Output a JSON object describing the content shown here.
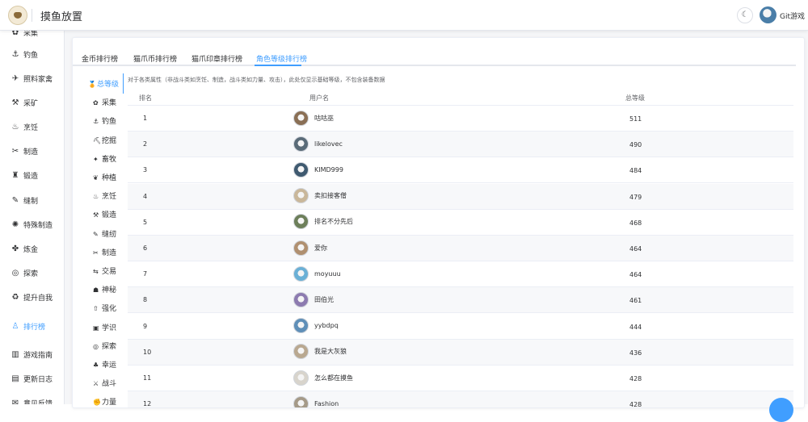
{
  "header": {
    "app_title": "摸鱼放置",
    "theme_icon": "moon-icon",
    "user_name": "Git游戏"
  },
  "sidebar": {
    "items": [
      {
        "label": "采集",
        "icon": "gather-icon",
        "active": false
      },
      {
        "label": "钓鱼",
        "icon": "fishing-icon",
        "active": false
      },
      {
        "label": "照料家禽",
        "icon": "poultry-icon",
        "active": false
      },
      {
        "label": "采矿",
        "icon": "mining-icon",
        "active": false
      },
      {
        "label": "烹饪",
        "icon": "cooking-icon",
        "active": false
      },
      {
        "label": "制造",
        "icon": "crafting-icon",
        "active": false
      },
      {
        "label": "锻造",
        "icon": "forging-icon",
        "active": false
      },
      {
        "label": "缝制",
        "icon": "sewing-icon",
        "active": false
      },
      {
        "label": "特殊制造",
        "icon": "special-craft-icon",
        "active": false
      },
      {
        "label": "炼金",
        "icon": "alchemy-icon",
        "active": false
      },
      {
        "label": "探索",
        "icon": "explore-icon",
        "active": false
      },
      {
        "label": "提升自我",
        "icon": "self-improve-icon",
        "active": false
      },
      {
        "label": "排行榜",
        "icon": "leaderboard-icon",
        "active": true
      },
      {
        "label": "游戏指南",
        "icon": "guide-icon",
        "active": false
      },
      {
        "label": "更新日志",
        "icon": "changelog-icon",
        "active": false
      },
      {
        "label": "意见反馈",
        "icon": "feedback-icon",
        "active": false
      }
    ]
  },
  "tabs": [
    {
      "label": "金币排行榜",
      "active": false
    },
    {
      "label": "猫爪币排行榜",
      "active": false
    },
    {
      "label": "猫爪印章排行榜",
      "active": false
    },
    {
      "label": "角色等级排行榜",
      "active": true
    }
  ],
  "subnav": [
    {
      "label": "总等级",
      "icon": "medal-icon",
      "active": true
    },
    {
      "label": "采集",
      "icon": "gather-icon",
      "active": false
    },
    {
      "label": "钓鱼",
      "icon": "fishing-icon",
      "active": false
    },
    {
      "label": "挖掘",
      "icon": "pickaxe-icon",
      "active": false
    },
    {
      "label": "畜牧",
      "icon": "livestock-icon",
      "active": false
    },
    {
      "label": "种植",
      "icon": "planting-icon",
      "active": false
    },
    {
      "label": "烹饪",
      "icon": "cooking-icon",
      "active": false
    },
    {
      "label": "锻造",
      "icon": "hammer-icon",
      "active": false
    },
    {
      "label": "缝纫",
      "icon": "sewing-icon",
      "active": false
    },
    {
      "label": "制造",
      "icon": "tools-icon",
      "active": false
    },
    {
      "label": "交易",
      "icon": "trade-icon",
      "active": false
    },
    {
      "label": "神秘",
      "icon": "mystic-icon",
      "active": false
    },
    {
      "label": "强化",
      "icon": "upgrade-icon",
      "active": false
    },
    {
      "label": "学识",
      "icon": "book-icon",
      "active": false
    },
    {
      "label": "探索",
      "icon": "compass-icon",
      "active": false
    },
    {
      "label": "幸运",
      "icon": "clover-icon",
      "active": false
    },
    {
      "label": "战斗",
      "icon": "fight-icon",
      "active": false
    },
    {
      "label": "力量",
      "icon": "strength-icon",
      "active": false
    }
  ],
  "description": "对于各类属性（非战斗类如烹饪、制造，战斗类如力量、攻击），此处仅显示基础等级，不包含装备数据",
  "table": {
    "headers": {
      "rank": "排名",
      "username": "用户名",
      "level": "总等级"
    },
    "rows": [
      {
        "rank": "1",
        "name": "咕咕巫",
        "level": "511",
        "avatar_color": "#8a6f55"
      },
      {
        "rank": "2",
        "name": "likelovec",
        "level": "490",
        "avatar_color": "#5a6b78"
      },
      {
        "rank": "3",
        "name": "KIMD999",
        "level": "484",
        "avatar_color": "#3f5a70"
      },
      {
        "rank": "4",
        "name": "卖扣接客僧",
        "level": "479",
        "avatar_color": "#c9b79a"
      },
      {
        "rank": "5",
        "name": "排名不分先后",
        "level": "468",
        "avatar_color": "#6d7f5a"
      },
      {
        "rank": "6",
        "name": "爱你",
        "level": "464",
        "avatar_color": "#b09070"
      },
      {
        "rank": "7",
        "name": "moyuuu",
        "level": "464",
        "avatar_color": "#6ab0d6"
      },
      {
        "rank": "8",
        "name": "田伯光",
        "level": "461",
        "avatar_color": "#8d7bb0"
      },
      {
        "rank": "9",
        "name": "yybdpq",
        "level": "444",
        "avatar_color": "#5f8fb8"
      },
      {
        "rank": "10",
        "name": "我是大灰狼",
        "level": "436",
        "avatar_color": "#b9a890"
      },
      {
        "rank": "11",
        "name": "怎么都在摸鱼",
        "level": "428",
        "avatar_color": "#d8d4cc"
      },
      {
        "rank": "12",
        "name": "Fashion",
        "level": "428",
        "avatar_color": "#a59a88"
      }
    ]
  }
}
